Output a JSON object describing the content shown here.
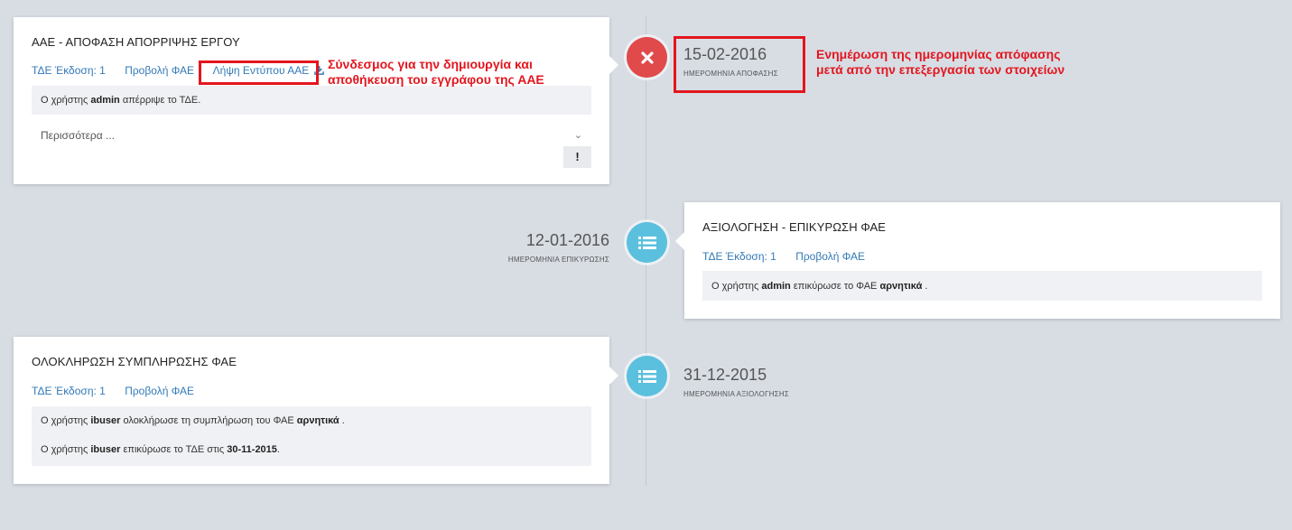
{
  "timeline": [
    {
      "title": "ΑΑΕ - ΑΠΟΦΑΣΗ ΑΠΟΡΡΙΨΗΣ ΕΡΓΟΥ",
      "links": [
        "ΤΔΕ Έκδοση: 1",
        "Προβολή ΦΑΕ",
        "Λήψη Εντύπου ΑΑΕ"
      ],
      "messages": [
        {
          "pre": "Ο χρήστης ",
          "user": "admin",
          "post": " απέρριψε το ΤΔΕ."
        }
      ],
      "more_label": "Περισσότερα ...",
      "action_label": "!",
      "date": "15-02-2016",
      "date_label": "ΗΜΕΡΟΜΗΝΙΑ ΑΠΟΦΑΣΗΣ",
      "icon": "close-icon",
      "status_color": "#e04a4a"
    },
    {
      "title": "ΑΞΙΟΛΟΓΗΣΗ - ΕΠΙΚΥΡΩΣΗ ΦΑΕ",
      "links": [
        "ΤΔΕ Έκδοση: 1",
        "Προβολή ΦΑΕ"
      ],
      "messages": [
        {
          "pre": "Ο χρήστης ",
          "user": "admin",
          "mid": " επικύρωσε το ΦΑΕ ",
          "bold2": "αρνητικά",
          "post": " ."
        }
      ],
      "date": "12-01-2016",
      "date_label": "ΗΜΕΡΟΜΗΝΙΑ ΕΠΙΚΥΡΩΣΗΣ",
      "icon": "list-icon",
      "status_color": "#5bc0de"
    },
    {
      "title": "ΟΛΟΚΛΗΡΩΣΗ ΣΥΜΠΛΗΡΩΣΗΣ ΦΑΕ",
      "links": [
        "ΤΔΕ Έκδοση: 1",
        "Προβολή ΦΑΕ"
      ],
      "messages": [
        {
          "pre": "Ο χρήστης ",
          "user": "ibuser",
          "mid": " ολοκλήρωσε τη συμπλήρωση του ΦΑΕ ",
          "bold2": "αρνητικά",
          "post": " ."
        },
        {
          "pre": "Ο χρήστης ",
          "user": "ibuser",
          "mid": " επικύρωσε το ΤΔΕ στις ",
          "bold2": "30-11-2015",
          "post": "."
        }
      ],
      "date": "31-12-2015",
      "date_label": "ΗΜΕΡΟΜΗΝΙΑ ΑΞΙΟΛΟΓΗΣΗΣ",
      "icon": "list-icon",
      "status_color": "#5bc0de"
    }
  ],
  "annotations": {
    "link_note_line1": "Σύνδεσμος για την δημιουργία και",
    "link_note_line2": "αποθήκευση του εγγράφου της ΑΑΕ",
    "date_note_line1": "Ενημέρωση της ημερομηνίας απόφασης",
    "date_note_line2": "μετά από την επεξεργασία των στοιχείων",
    "highlight_color": "#e3161e"
  }
}
